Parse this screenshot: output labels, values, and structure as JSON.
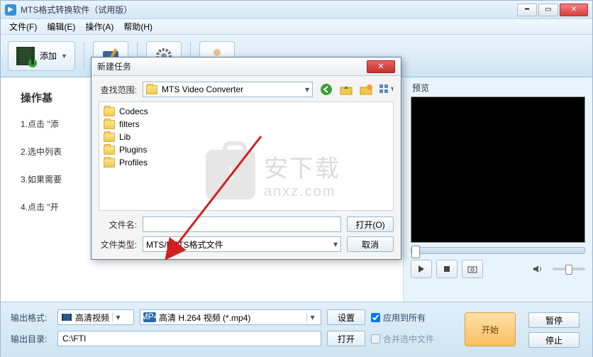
{
  "window": {
    "title": "MTS格式转换软件（试用版）"
  },
  "menu": {
    "file": "文件(F)",
    "edit": "编辑(E)",
    "action": "操作(A)",
    "help": "帮助(H)"
  },
  "toolbar": {
    "add": "添加"
  },
  "steps": {
    "heading": "操作基",
    "s1": "1.点击 \"添",
    "s2": "2.选中列表",
    "s3": "3.如果需要",
    "s4": "4.点击 \"开"
  },
  "preview": {
    "label": "预览"
  },
  "bottom": {
    "out_format_lbl": "输出格式:",
    "format_cat": "高清视频",
    "format_val": "高清 H.264 视频 (*.mp4)",
    "settings": "设置",
    "apply_all": "应用到所有",
    "merge": "合并选中文件",
    "start": "开始",
    "pause": "暂停",
    "stop": "停止",
    "out_dir_lbl": "输出目录:",
    "out_dir_val": "C:\\FTI",
    "open": "打开"
  },
  "dialog": {
    "title": "新建任务",
    "lookin_lbl": "查找范围:",
    "lookin_val": "MTS Video Converter",
    "folders": [
      "Codecs",
      "filters",
      "Lib",
      "Plugins",
      "Profiles"
    ],
    "filename_lbl": "文件名:",
    "filename_val": "",
    "filetype_lbl": "文件类型:",
    "filetype_val": "MTS/M2TS格式文件",
    "open_btn": "打开(O)",
    "cancel_btn": "取消"
  },
  "watermark": {
    "cn": "安下载",
    "url": "anxz.com"
  }
}
